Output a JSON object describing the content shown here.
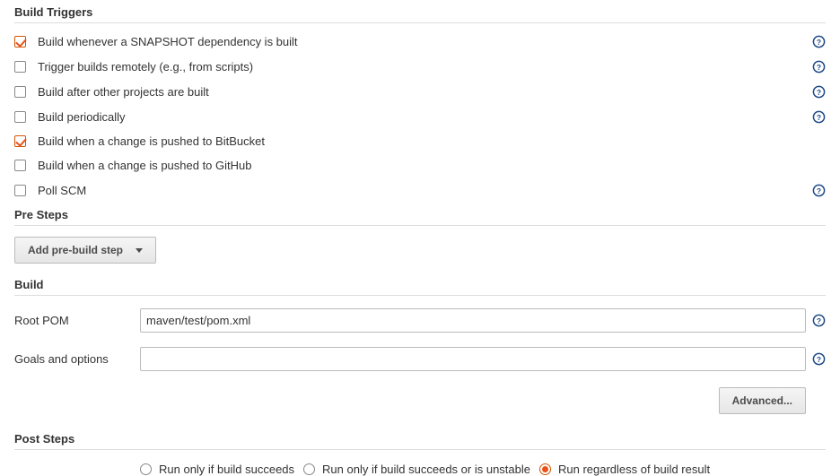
{
  "sections": {
    "triggers_title": "Build Triggers",
    "presteps_title": "Pre Steps",
    "build_title": "Build",
    "poststeps_title": "Post Steps"
  },
  "triggers": [
    {
      "label": "Build whenever a SNAPSHOT dependency is built",
      "checked": true,
      "help": true
    },
    {
      "label": "Trigger builds remotely (e.g., from scripts)",
      "checked": false,
      "help": true
    },
    {
      "label": "Build after other projects are built",
      "checked": false,
      "help": true
    },
    {
      "label": "Build periodically",
      "checked": false,
      "help": true
    },
    {
      "label": "Build when a change is pushed to BitBucket",
      "checked": true,
      "help": false
    },
    {
      "label": "Build when a change is pushed to GitHub",
      "checked": false,
      "help": false
    },
    {
      "label": "Poll SCM",
      "checked": false,
      "help": true
    }
  ],
  "presteps": {
    "add_label": "Add pre-build step"
  },
  "build": {
    "root_pom_label": "Root POM",
    "root_pom_value": "maven/test/pom.xml",
    "goals_label": "Goals and options",
    "goals_value": "",
    "advanced_label": "Advanced..."
  },
  "poststeps": {
    "options": [
      {
        "label": "Run only if build succeeds",
        "checked": false
      },
      {
        "label": "Run only if build succeeds or is unstable",
        "checked": false
      },
      {
        "label": "Run regardless of build result",
        "checked": true
      }
    ]
  }
}
